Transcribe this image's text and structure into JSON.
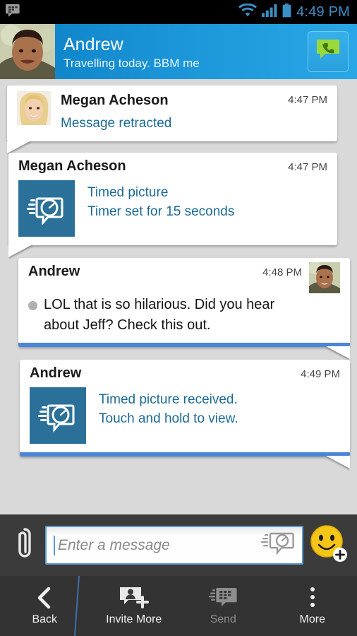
{
  "statusbar": {
    "time": "4:49 PM",
    "icons": [
      "bbm-notification-icon",
      "wifi-icon",
      "cellular-signal-icon",
      "battery-icon"
    ],
    "accent_color": "#3a8fc4"
  },
  "header": {
    "contact_name": "Andrew",
    "contact_status": "Travelling today.  BBM me",
    "avatar": "contact-photo-andrew",
    "action_icon": "voice-call-icon",
    "gradient_from": "#0c7fc4",
    "gradient_to": "#29a7e6"
  },
  "conversation": {
    "messages": [
      {
        "sender": "Megan Acheson",
        "time": "4:47 PM",
        "direction": "incoming",
        "has_avatar": true,
        "avatar": "contact-photo-megan",
        "body": "Message retracted",
        "body_style": "link",
        "type": "retracted"
      },
      {
        "sender": "Megan Acheson",
        "time": "4:47 PM",
        "direction": "incoming",
        "has_avatar": false,
        "body": "Timed picture",
        "body2": "Timer set for 15 seconds",
        "body_style": "link",
        "type": "timed-picture",
        "thumb_icon": "timed-picture-icon",
        "thumb_color": "#2b7099"
      },
      {
        "sender": "Andrew",
        "time": "4:48 PM",
        "direction": "outgoing",
        "has_avatar": true,
        "avatar": "contact-photo-andrew",
        "body": "LOL that is so hilarious.  Did you hear about Jeff?  Check this out.",
        "body_style": "plain",
        "type": "text",
        "delivery_dot": true
      },
      {
        "sender": "Andrew",
        "time": "4:49 PM",
        "direction": "outgoing",
        "has_avatar": false,
        "body": "Timed picture received.",
        "body2": "Touch and hold to view.",
        "body_style": "link",
        "type": "timed-picture",
        "thumb_icon": "timed-picture-icon",
        "thumb_color": "#2b7099"
      }
    ],
    "background_color": "#d9d9d9",
    "outgoing_accent": "#4a86d8",
    "link_color": "#1b6a96"
  },
  "input": {
    "attach_icon": "paperclip-icon",
    "placeholder": "Enter a message",
    "value": "",
    "field_icon": "timed-message-icon",
    "emoticon_icon": "smiley-add-icon"
  },
  "navbar": {
    "items": [
      {
        "label": "Back",
        "icon": "chevron-left-icon",
        "enabled": true
      },
      {
        "label": "Invite More",
        "icon": "invite-contact-icon",
        "enabled": true
      },
      {
        "label": "Send",
        "icon": "bbm-send-icon",
        "enabled": false
      },
      {
        "label": "More",
        "icon": "overflow-dots-icon",
        "enabled": true
      }
    ]
  }
}
